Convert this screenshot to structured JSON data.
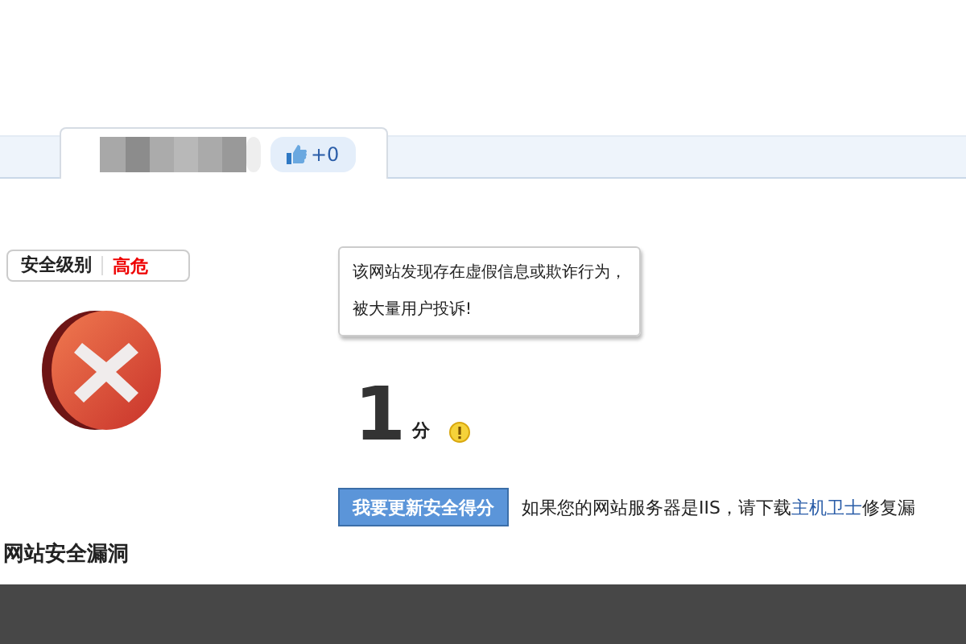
{
  "tab": {
    "likes": "+0"
  },
  "level": {
    "label": "安全级别",
    "value": "高危"
  },
  "tooltip": "该网站发现存在虚假信息或欺诈行为，被大量用户投诉!",
  "score": {
    "value": "1",
    "unit": "分"
  },
  "update_button": "我要更新安全得分",
  "notice": {
    "before": "如果您的网站服务器是IIS，请下载",
    "link": "主机卫士",
    "after": "修复漏"
  },
  "section_title": "网站安全漏洞"
}
